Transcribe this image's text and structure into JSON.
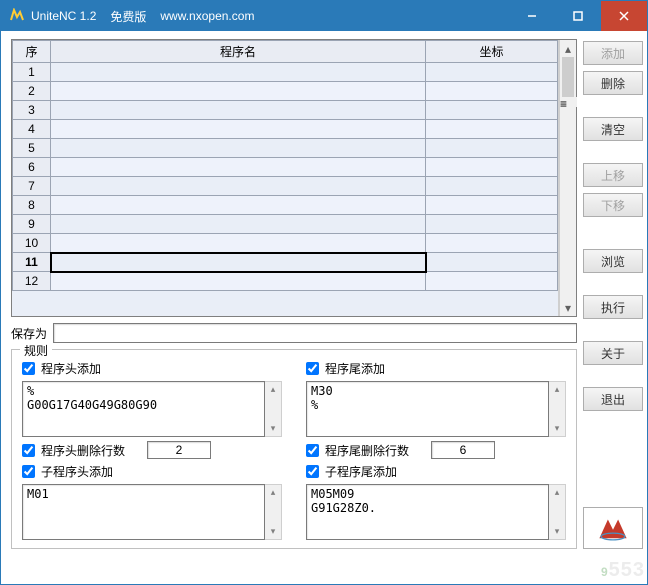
{
  "titlebar": {
    "title": "UniteNC 1.2",
    "edition": "免费版",
    "url": "www.nxopen.com"
  },
  "table": {
    "headers": {
      "seq": "序",
      "prog": "程序名",
      "coord": "坐标"
    },
    "rows": [
      {
        "n": "1"
      },
      {
        "n": "2"
      },
      {
        "n": "3"
      },
      {
        "n": "4"
      },
      {
        "n": "5"
      },
      {
        "n": "6"
      },
      {
        "n": "7"
      },
      {
        "n": "8"
      },
      {
        "n": "9"
      },
      {
        "n": "10"
      },
      {
        "n": "11"
      },
      {
        "n": "12"
      }
    ],
    "selected_row": "11"
  },
  "saveas": {
    "label": "保存为",
    "value": ""
  },
  "rules": {
    "title": "规则",
    "head_add": {
      "label": "程序头添加",
      "checked": true,
      "text": "%\nG00G17G40G49G80G90"
    },
    "tail_add": {
      "label": "程序尾添加",
      "checked": true,
      "text": "M30\n%"
    },
    "head_del": {
      "label": "程序头删除行数",
      "checked": true,
      "value": "2"
    },
    "tail_del": {
      "label": "程序尾删除行数",
      "checked": true,
      "value": "6"
    },
    "sub_head": {
      "label": "子程序头添加",
      "checked": true,
      "text": "M01"
    },
    "sub_tail": {
      "label": "子程序尾添加",
      "checked": true,
      "text": "M05M09\nG91G28Z0."
    }
  },
  "buttons": {
    "add": "添加",
    "del": "删除",
    "clear": "清空",
    "up": "上移",
    "down": "下移",
    "browse": "浏览",
    "exec": "执行",
    "about": "关于",
    "exit": "退出"
  }
}
